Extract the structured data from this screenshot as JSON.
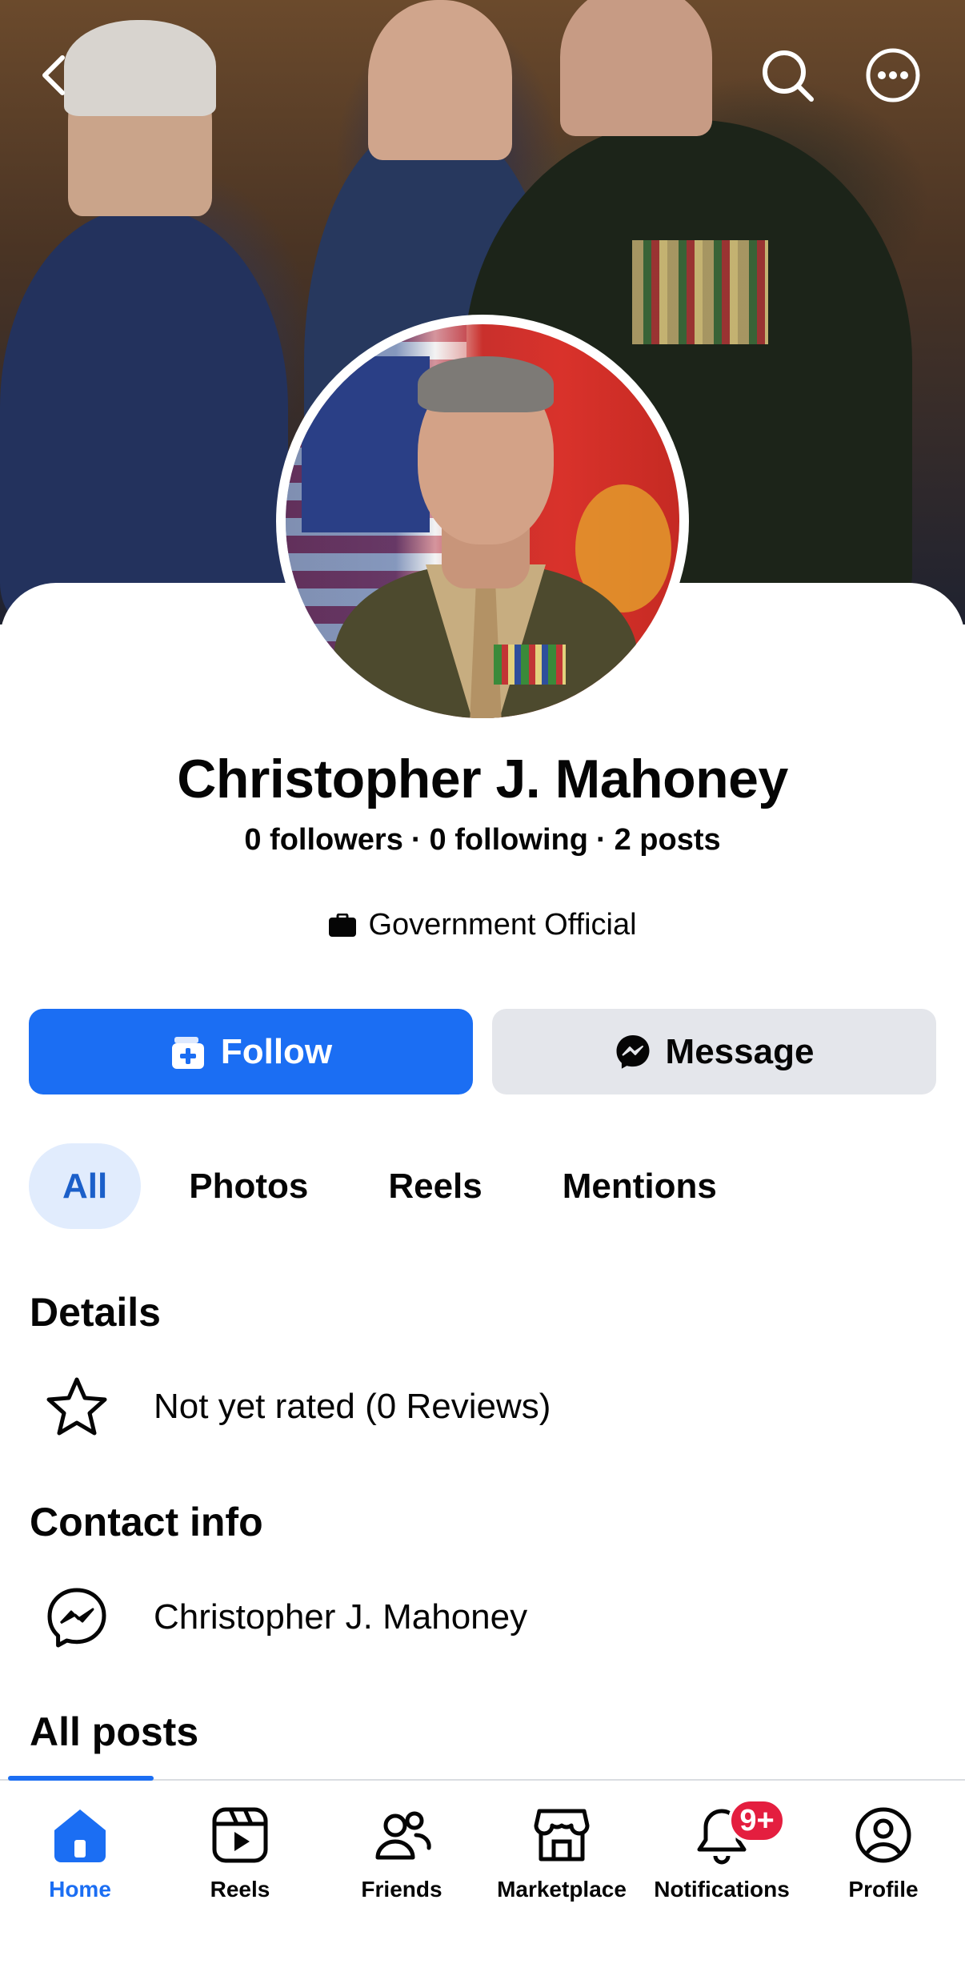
{
  "header": {
    "back_icon": "chevron-left-icon",
    "search_icon": "search-icon",
    "more_icon": "more-horizontal-icon"
  },
  "profile": {
    "name": "Christopher J. Mahoney",
    "followers": "0 followers",
    "following": "0 following",
    "posts": "2 posts",
    "separator": "·",
    "category": "Government Official"
  },
  "actions": {
    "follow_label": "Follow",
    "message_label": "Message",
    "follow_color": "#1b6ef3"
  },
  "tabs": [
    {
      "label": "All",
      "active": true
    },
    {
      "label": "Photos",
      "active": false
    },
    {
      "label": "Reels",
      "active": false
    },
    {
      "label": "Mentions",
      "active": false
    }
  ],
  "details": {
    "title": "Details",
    "rating_text": "Not yet rated (0 Reviews)"
  },
  "contact": {
    "title": "Contact info",
    "messenger_name": "Christopher J. Mahoney"
  },
  "posts_section": {
    "title": "All posts"
  },
  "bottom_nav": [
    {
      "label": "Home",
      "icon": "home-icon",
      "active": true
    },
    {
      "label": "Reels",
      "icon": "reels-icon",
      "active": false
    },
    {
      "label": "Friends",
      "icon": "friends-icon",
      "active": false
    },
    {
      "label": "Marketplace",
      "icon": "marketplace-icon",
      "active": false
    },
    {
      "label": "Notifications",
      "icon": "bell-icon",
      "active": false,
      "badge": "9+"
    },
    {
      "label": "Profile",
      "icon": "profile-icon",
      "active": false
    }
  ]
}
